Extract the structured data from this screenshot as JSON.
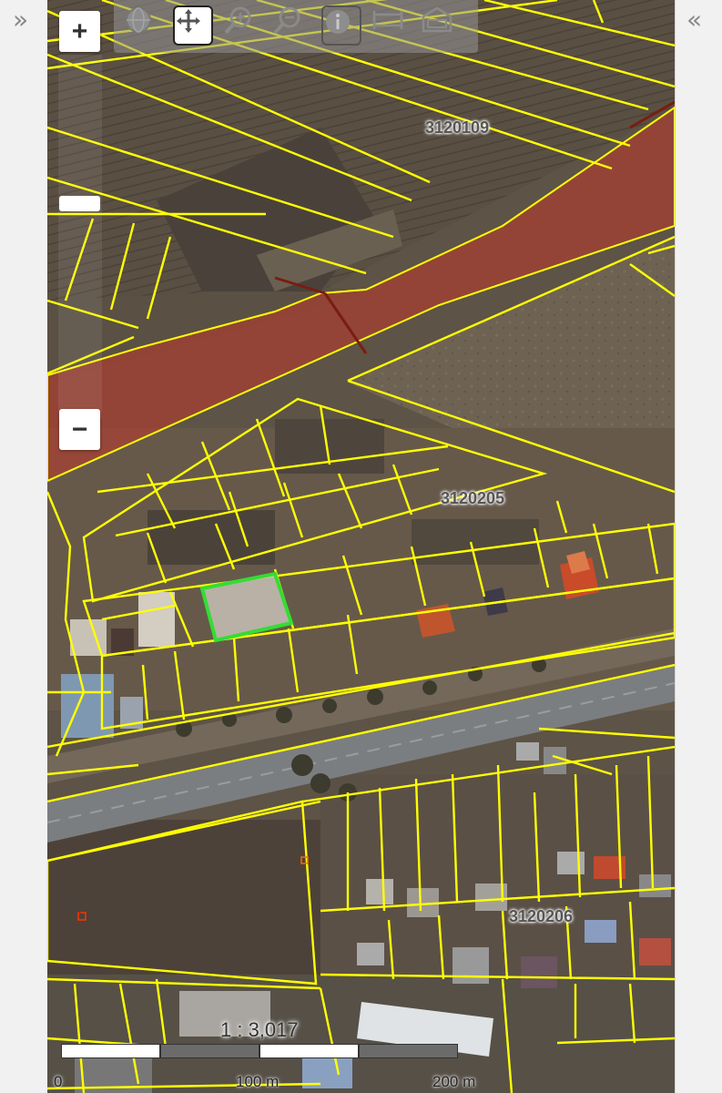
{
  "nav": {
    "left_toggle": "»",
    "right_toggle": "«"
  },
  "zoom": {
    "plus": "+",
    "minus": "−"
  },
  "toolbar": {
    "tools": [
      "globe-icon",
      "pan-icon",
      "zoom-in-icon",
      "zoom-out-icon",
      "info-icon",
      "measure-distance-icon",
      "measure-area-icon"
    ],
    "active_tool": "pan-icon"
  },
  "parcel_labels": {
    "top": "3120109",
    "middle": "3120205",
    "bottom": "3120206"
  },
  "scale": {
    "ratio": "1 : 3,017",
    "ticks": [
      "0",
      "100 m",
      "200 m"
    ]
  },
  "colors": {
    "parcel_outline": "#ffff00",
    "selected_parcel": "#33dd33",
    "zone_overlay": "#c0392b"
  }
}
